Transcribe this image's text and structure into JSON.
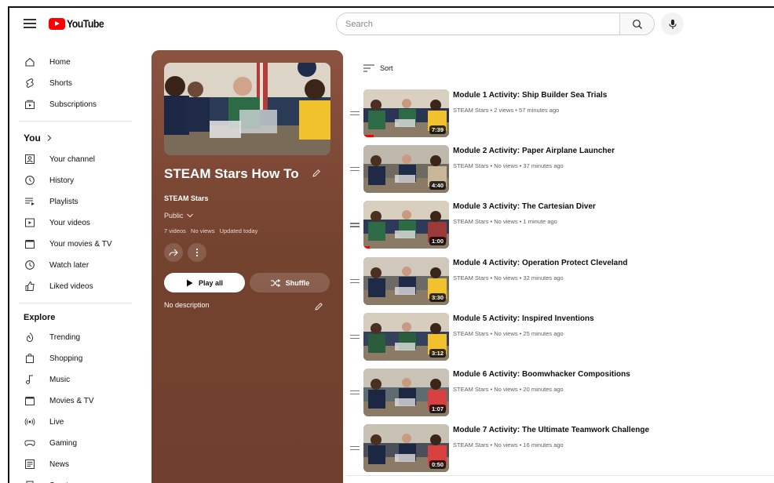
{
  "header": {
    "logo_text": "YouTube",
    "search_placeholder": "Search"
  },
  "sidebar": {
    "main": [
      {
        "label": "Home",
        "icon": "home-icon"
      },
      {
        "label": "Shorts",
        "icon": "shorts-icon"
      },
      {
        "label": "Subscriptions",
        "icon": "subscriptions-icon"
      }
    ],
    "you_heading": "You",
    "you_items": [
      {
        "label": "Your channel",
        "icon": "channel-icon"
      },
      {
        "label": "History",
        "icon": "history-icon"
      },
      {
        "label": "Playlists",
        "icon": "playlists-icon"
      },
      {
        "label": "Your videos",
        "icon": "your-videos-icon"
      },
      {
        "label": "Your movies & TV",
        "icon": "movies-icon"
      },
      {
        "label": "Watch later",
        "icon": "watch-later-icon"
      },
      {
        "label": "Liked videos",
        "icon": "liked-icon"
      }
    ],
    "explore_heading": "Explore",
    "explore_items": [
      {
        "label": "Trending",
        "icon": "trending-icon"
      },
      {
        "label": "Shopping",
        "icon": "shopping-icon"
      },
      {
        "label": "Music",
        "icon": "music-icon"
      },
      {
        "label": "Movies & TV",
        "icon": "movies-tv-icon"
      },
      {
        "label": "Live",
        "icon": "live-icon"
      },
      {
        "label": "Gaming",
        "icon": "gaming-icon"
      },
      {
        "label": "News",
        "icon": "news-icon"
      },
      {
        "label": "Sports",
        "icon": "sports-icon"
      }
    ]
  },
  "playlist": {
    "title": "STEAM Stars How To",
    "channel": "STEAM Stars",
    "privacy": "Public",
    "video_count": "7 videos",
    "views": "No views",
    "updated": "Updated today",
    "play_all_label": "Play all",
    "shuffle_label": "Shuffle",
    "description": "No description",
    "sort_label": "Sort"
  },
  "videos": [
    {
      "title": "Module 1 Activity: Ship Builder Sea Trials",
      "meta": "STEAM Stars • 2 views • 57 minutes ago",
      "duration": "7:39",
      "watched": 0.12
    },
    {
      "title": "Module 2 Activity: Paper Airplane Launcher",
      "meta": "STEAM Stars • No views • 37 minutes ago",
      "duration": "4:40",
      "watched": 0.0
    },
    {
      "title": "Module 3 Activity: The Cartesian Diver",
      "meta": "STEAM Stars • No views • 1 minute ago",
      "duration": "1:00",
      "watched": 0.07
    },
    {
      "title": "Module 4 Activity: Operation Protect Cleveland",
      "meta": "STEAM Stars • No views • 32 minutes ago",
      "duration": "3:30",
      "watched": 0.0
    },
    {
      "title": "Module 5 Activity: Inspired Inventions",
      "meta": "STEAM Stars • No views • 25 minutes ago",
      "duration": "3:12",
      "watched": 0.0
    },
    {
      "title": "Module 6 Activity: Boomwhacker Compositions",
      "meta": "STEAM Stars • No views • 20 minutes ago",
      "duration": "1:07",
      "watched": 0.0
    },
    {
      "title": "Module 7 Activity: The Ultimate Teamwork Challenge",
      "meta": "STEAM Stars • No views • 16 minutes ago",
      "duration": "0:50",
      "watched": 0.0
    }
  ],
  "colors": {
    "brand_red": "#ff0000",
    "panel_bg": "#7a4735"
  }
}
